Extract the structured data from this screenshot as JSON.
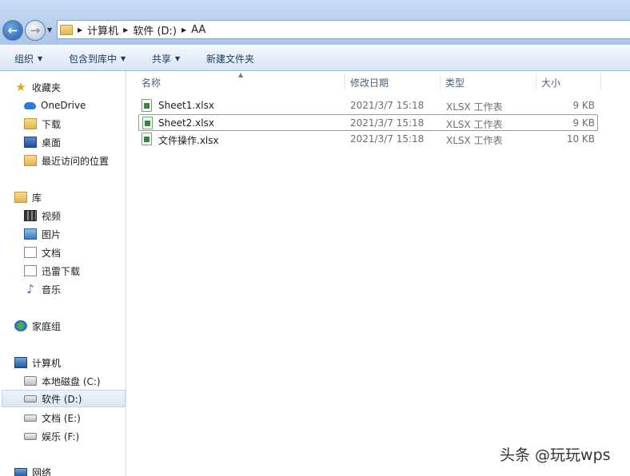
{
  "address": {
    "crumbs": [
      "计算机",
      "软件 (D:)",
      "AA"
    ]
  },
  "toolbar": {
    "organize": "组织",
    "include_library": "包含到库中",
    "share": "共享",
    "new_folder": "新建文件夹"
  },
  "nav": {
    "favorites": "收藏夹",
    "onedrive": "OneDrive",
    "downloads": "下载",
    "desktop": "桌面",
    "recent": "最近访问的位置",
    "libraries": "库",
    "videos": "视频",
    "pictures": "图片",
    "documents": "文档",
    "xunlei": "迅雷下载",
    "music": "音乐",
    "homegroup": "家庭组",
    "computer": "计算机",
    "drive_c": "本地磁盘 (C:)",
    "drive_d": "软件 (D:)",
    "drive_e": "文档 (E:)",
    "drive_f": "娱乐 (F:)",
    "network": "网络"
  },
  "columns": {
    "name": "名称",
    "modified": "修改日期",
    "type": "类型",
    "size": "大小"
  },
  "files": [
    {
      "name": "Sheet1.xlsx",
      "modified": "2021/3/7 15:18",
      "type": "XLSX 工作表",
      "size": "9 KB"
    },
    {
      "name": "Sheet2.xlsx",
      "modified": "2021/3/7 15:18",
      "type": "XLSX 工作表",
      "size": "9 KB"
    },
    {
      "name": "文件操作.xlsx",
      "modified": "2021/3/7 15:18",
      "type": "XLSX 工作表",
      "size": "10 KB"
    }
  ],
  "watermark": "头条 @玩玩wps"
}
